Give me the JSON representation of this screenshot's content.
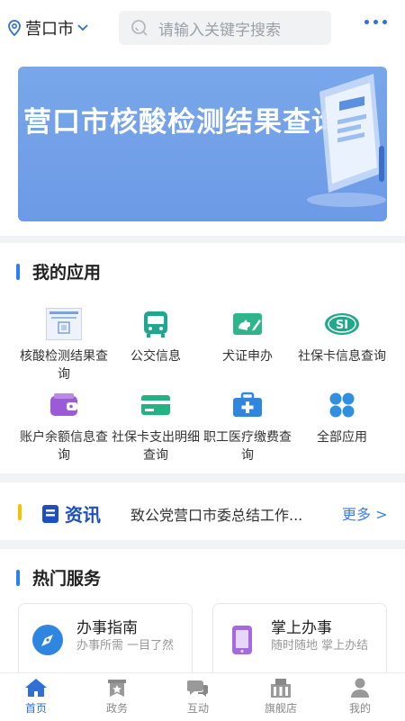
{
  "header": {
    "city": "营口市",
    "search_placeholder": "请输入关键字搜索"
  },
  "banner": {
    "title": "营口市核酸检测结果查询"
  },
  "my_apps": {
    "title": "我的应用",
    "items": [
      {
        "label": "核酸检测结果查询",
        "icon": "nucleic-test-thumbnail-icon"
      },
      {
        "label": "公交信息",
        "icon": "bus-icon"
      },
      {
        "label": "犬证申办",
        "icon": "dog-license-icon"
      },
      {
        "label": "社保卡信息查询",
        "icon": "social-security-si-icon"
      },
      {
        "label": "账户余额信息查询",
        "icon": "wallet-icon"
      },
      {
        "label": "社保卡支出明细查询",
        "icon": "card-icon"
      },
      {
        "label": "职工医疗缴费查询",
        "icon": "medical-kit-icon"
      },
      {
        "label": "全部应用",
        "icon": "all-apps-grid-icon"
      }
    ]
  },
  "news": {
    "tag": "资讯",
    "headline": "致公党营口市委总结工作...",
    "more_label": "更多 >"
  },
  "hot_services": {
    "title": "热门服务",
    "cards": [
      {
        "title": "办事指南",
        "desc": "办事所需 一目了然",
        "icon": "compass-icon"
      },
      {
        "title": "掌上办事",
        "desc": "随时随地 掌上办结",
        "icon": "mobile-phone-icon"
      }
    ]
  },
  "tabbar": {
    "items": [
      {
        "label": "首页",
        "icon": "home-icon",
        "active": true
      },
      {
        "label": "政务",
        "icon": "government-star-icon",
        "active": false
      },
      {
        "label": "互动",
        "icon": "interaction-icon",
        "active": false
      },
      {
        "label": "旗舰店",
        "icon": "building-icon",
        "active": false
      },
      {
        "label": "我的",
        "icon": "user-icon",
        "active": false
      }
    ]
  },
  "colors": {
    "accent": "#2f6fd6",
    "banner": "#6d9ae6",
    "section_bar": "#2f80ed",
    "news_bar": "#f2c200"
  }
}
